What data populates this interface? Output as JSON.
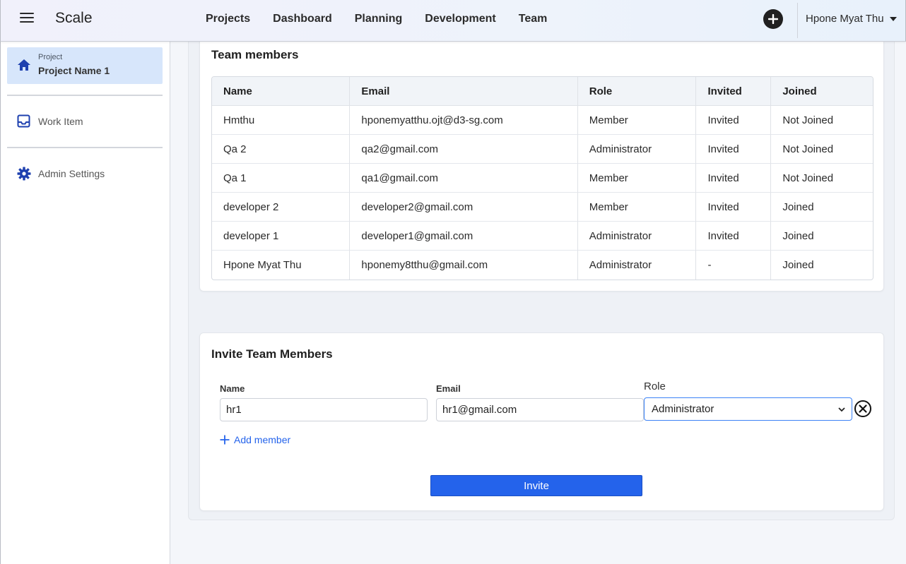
{
  "header": {
    "brand": "Scale",
    "nav": [
      "Projects",
      "Dashboard",
      "Planning",
      "Development",
      "Team"
    ],
    "user_name": "Hpone Myat Thu"
  },
  "sidebar": {
    "project_caption": "Project",
    "project_name": "Project Name 1",
    "items": [
      {
        "label": "Work Item",
        "icon": "inbox-icon"
      },
      {
        "label": "Admin Settings",
        "icon": "gear-icon"
      }
    ]
  },
  "team": {
    "title": "Team members",
    "columns": [
      "Name",
      "Email",
      "Role",
      "Invited",
      "Joined"
    ],
    "rows": [
      [
        "Hmthu",
        "hponemyatthu.ojt@d3-sg.com",
        "Member",
        "Invited",
        "Not Joined"
      ],
      [
        "Qa 2",
        "qa2@gmail.com",
        "Administrator",
        "Invited",
        "Not Joined"
      ],
      [
        "Qa 1",
        "qa1@gmail.com",
        "Member",
        "Invited",
        "Not Joined"
      ],
      [
        "developer 2",
        "developer2@gmail.com",
        "Member",
        "Invited",
        "Joined"
      ],
      [
        "developer 1",
        "developer1@gmail.com",
        "Administrator",
        "Invited",
        "Joined"
      ],
      [
        "Hpone Myat Thu",
        "hponemy8tthu@gmail.com",
        "Administrator",
        "-",
        "Joined"
      ]
    ]
  },
  "invite": {
    "title": "Invite Team Members",
    "name_label": "Name",
    "email_label": "Email",
    "role_label": "Role",
    "name_value": "hr1",
    "email_value": "hr1@gmail.com",
    "role_value": "Administrator",
    "add_member": "Add member",
    "invite_button": "Invite"
  },
  "colors": {
    "accent": "#2463eb",
    "active_sidebar": "#d7e6fb"
  }
}
